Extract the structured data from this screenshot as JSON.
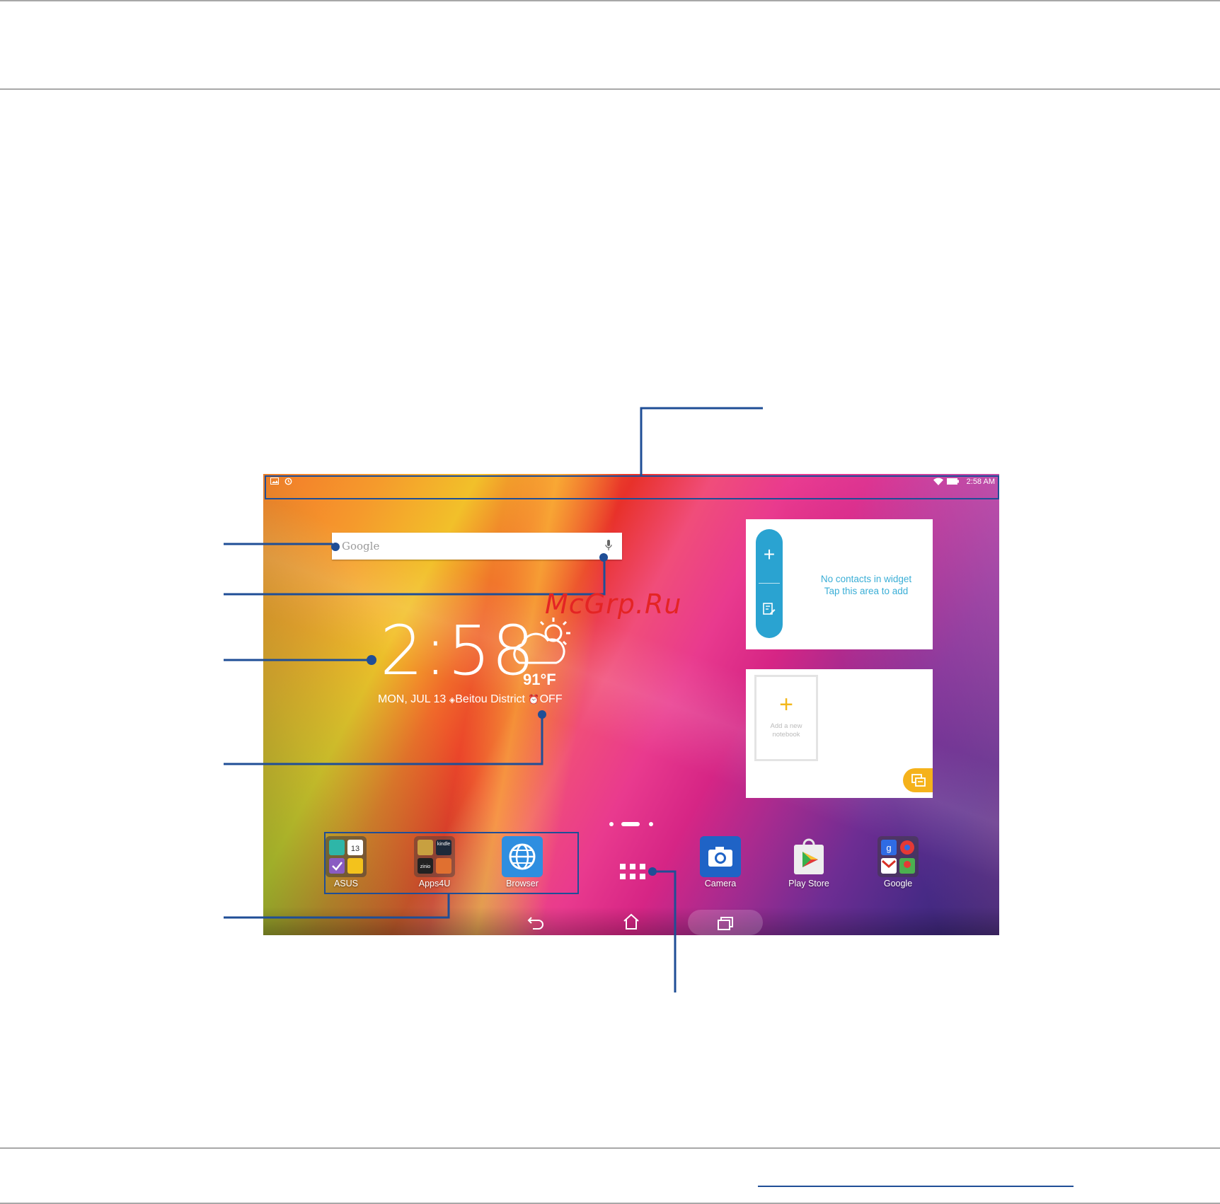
{
  "status_bar": {
    "time": "2:58 AM"
  },
  "search_widget": {
    "placeholder": "Google"
  },
  "clock_widget": {
    "time": "2:58",
    "temperature": "91°F",
    "date": "MON, JUL 13",
    "location": "Beitou District",
    "alarm": "OFF"
  },
  "contacts_widget": {
    "line1": "No contacts in widget",
    "line2": "Tap this area to add"
  },
  "notebook_widget": {
    "label_line1": "Add a new",
    "label_line2": "notebook"
  },
  "favorite_apps": [
    {
      "label": "ASUS"
    },
    {
      "label": "Apps4U"
    },
    {
      "label": "Browser"
    }
  ],
  "dock_apps": [
    {
      "label": "Camera"
    },
    {
      "label": "Play Store"
    },
    {
      "label": "Google"
    }
  ],
  "watermark": "McGrp.Ru",
  "colors": {
    "callout_blue": "#1f4e96",
    "widget_blue": "#2aa3d1",
    "accent_yellow": "#f5b21b"
  }
}
